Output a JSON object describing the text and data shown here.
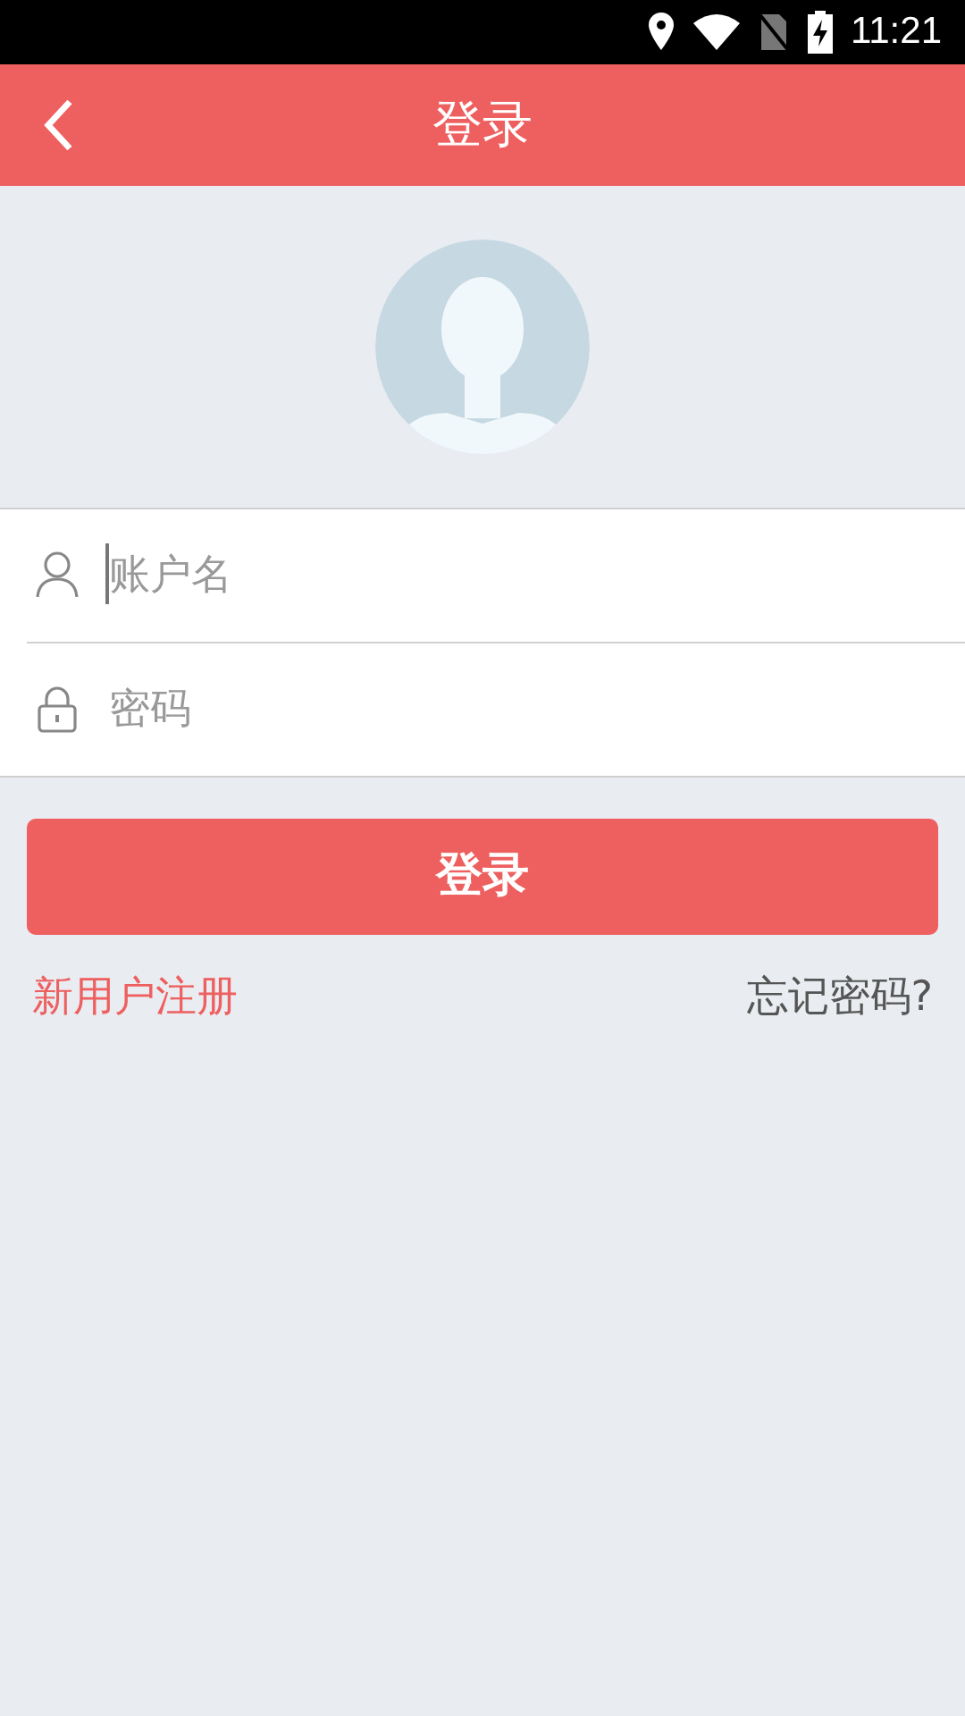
{
  "status_bar": {
    "time": "11:21"
  },
  "header": {
    "title": "登录"
  },
  "form": {
    "fields": [
      {
        "kind": "user",
        "placeholder": "账户名",
        "focused": true
      },
      {
        "kind": "lock",
        "placeholder": "密码",
        "focused": false
      }
    ]
  },
  "login_button": "登录",
  "links": {
    "register": "新用户注册",
    "forgot": "忘记密码?"
  }
}
